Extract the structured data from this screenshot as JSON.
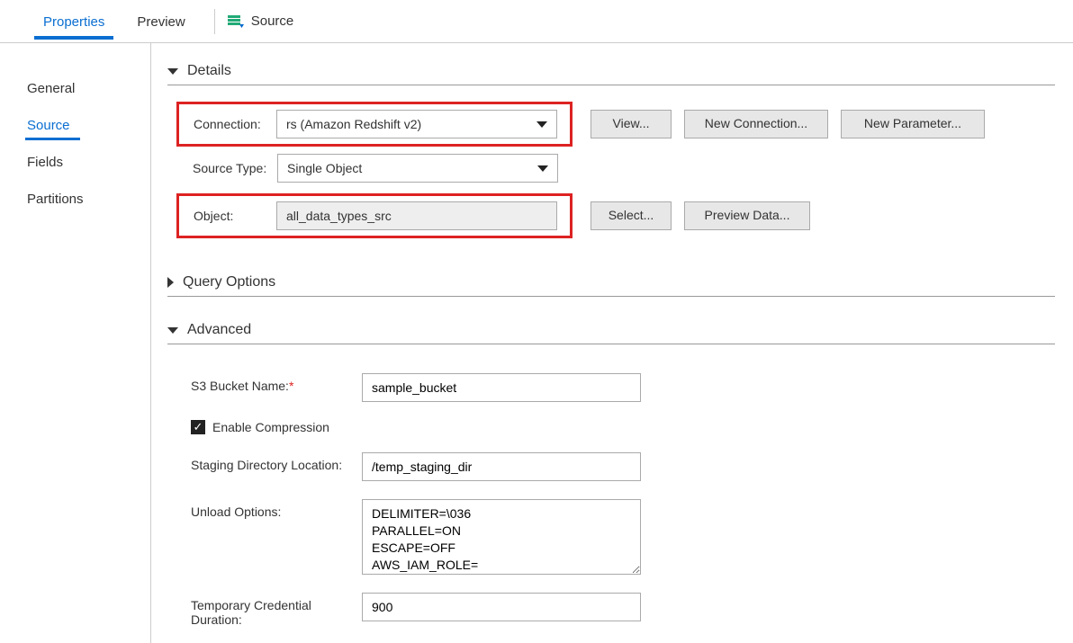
{
  "topTabs": {
    "properties": "Properties",
    "preview": "Preview",
    "sourceLabel": "Source"
  },
  "sidebar": {
    "general": "General",
    "source": "Source",
    "fields": "Fields",
    "partitions": "Partitions"
  },
  "sections": {
    "details": "Details",
    "queryOptions": "Query Options",
    "advanced": "Advanced"
  },
  "details": {
    "connectionLabel": "Connection:",
    "connectionValue": "rs (Amazon Redshift v2)",
    "sourceTypeLabel": "Source Type:",
    "sourceTypeValue": "Single Object",
    "objectLabel": "Object:",
    "objectValue": "all_data_types_src",
    "buttons": {
      "view": "View...",
      "newConnection": "New Connection...",
      "newParameter": "New Parameter...",
      "select": "Select...",
      "previewData": "Preview Data..."
    }
  },
  "advanced": {
    "s3BucketLabel": "S3 Bucket Name:",
    "s3BucketValue": "sample_bucket",
    "enableCompressionLabel": "Enable Compression",
    "enableCompressionChecked": true,
    "stagingDirLabel": "Staging Directory Location:",
    "stagingDirValue": "/temp_staging_dir",
    "unloadOptionsLabel": "Unload Options:",
    "unloadOptionsValue": "DELIMITER=\\036\nPARALLEL=ON\nESCAPE=OFF\nAWS_IAM_ROLE=",
    "tempCredLabel": "Temporary Credential Duration:",
    "tempCredValue": "900"
  }
}
